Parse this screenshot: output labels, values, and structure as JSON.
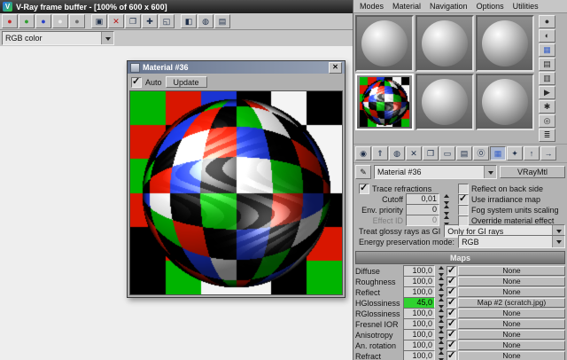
{
  "colors": {
    "sel_green": "#2fd22f",
    "panel": "#b3b3b3",
    "accent_blue": "#3a62c8"
  },
  "vfb": {
    "title": "V-Ray frame buffer - [100% of 600 x 600]",
    "logo_glyph": "V",
    "channel": "RGB color",
    "toolbar": [
      {
        "name": "red-channel-icon",
        "glyph": "●",
        "color": "#c62828"
      },
      {
        "name": "green-channel-icon",
        "glyph": "●",
        "color": "#2e9e2e"
      },
      {
        "name": "blue-channel-icon",
        "glyph": "●",
        "color": "#2840c8"
      },
      {
        "name": "alpha-channel-icon",
        "glyph": "●",
        "color": "#ececec"
      },
      {
        "name": "monochrome-channel-icon",
        "glyph": "●",
        "color": "#6d6d6d"
      },
      {
        "sep": true,
        "glyph": ""
      },
      {
        "name": "save-image-icon",
        "glyph": "▣",
        "color": "#20304a"
      },
      {
        "name": "clear-image-icon",
        "glyph": "✕",
        "color": "#b81616"
      },
      {
        "name": "duplicate-to-host-icon",
        "glyph": "❐",
        "color": "#20304a"
      },
      {
        "name": "track-mouse-icon",
        "glyph": "✚",
        "color": "#20304a"
      },
      {
        "name": "region-render-icon",
        "glyph": "◱",
        "color": "#20304a"
      },
      {
        "sep": true,
        "glyph": ""
      },
      {
        "name": "color-correction-icon",
        "glyph": "◧",
        "color": "#20304a"
      },
      {
        "name": "srgb-icon",
        "glyph": "◍",
        "color": "#20304a"
      },
      {
        "name": "stamp-icon",
        "glyph": "▤",
        "color": "#20304a"
      }
    ]
  },
  "preview": {
    "title": "Material #36",
    "auto_label": "Auto",
    "auto_checked": true,
    "update_label": "Update",
    "palette": [
      "#000000",
      "#f4f4f4",
      "#d81600",
      "#00b400",
      "#1a34d2"
    ],
    "bg_grid": [
      [
        3,
        2,
        4,
        0,
        1,
        0
      ],
      [
        2,
        0,
        3,
        4,
        0,
        1
      ],
      [
        3,
        4,
        0,
        2,
        3,
        1
      ],
      [
        2,
        0,
        3,
        1,
        4,
        0
      ],
      [
        0,
        2,
        4,
        3,
        0,
        2
      ],
      [
        0,
        3,
        1,
        1,
        0,
        3
      ]
    ],
    "sphere_grid": [
      [
        2,
        0,
        3,
        4,
        0,
        2,
        1,
        0
      ],
      [
        0,
        4,
        2,
        0,
        3,
        1,
        0,
        4
      ],
      [
        3,
        0,
        1,
        2,
        4,
        0,
        2,
        0
      ],
      [
        0,
        2,
        4,
        0,
        1,
        3,
        0,
        2
      ],
      [
        4,
        1,
        0,
        3,
        0,
        2,
        4,
        0
      ],
      [
        0,
        3,
        2,
        0,
        4,
        0,
        1,
        3
      ],
      [
        2,
        0,
        4,
        1,
        0,
        3,
        0,
        0
      ],
      [
        0,
        2,
        0,
        3,
        2,
        0,
        4,
        1
      ]
    ]
  },
  "editor": {
    "menus": [
      {
        "name": "menu-modes",
        "label": "Modes"
      },
      {
        "name": "menu-material",
        "label": "Material"
      },
      {
        "name": "menu-navigation",
        "label": "Navigation"
      },
      {
        "name": "menu-options",
        "label": "Options"
      },
      {
        "name": "menu-utilities",
        "label": "Utilities"
      }
    ],
    "vtoolbar": [
      {
        "name": "sample-type-icon",
        "glyph": "●",
        "color": "#2a2a2a"
      },
      {
        "name": "backlight-icon",
        "glyph": "◐",
        "color": "#2a2a2a"
      },
      {
        "name": "background-icon",
        "glyph": "▦",
        "color": "#3a62c8"
      },
      {
        "name": "sample-uv-tiling-icon",
        "glyph": "▤",
        "color": "#2a2a2a"
      },
      {
        "name": "video-color-check-icon",
        "glyph": "▥",
        "color": "#2a2a2a"
      },
      {
        "name": "make-preview-icon",
        "glyph": "▶",
        "color": "#2a2a2a"
      },
      {
        "name": "options-icon",
        "glyph": "✱",
        "color": "#2a2a2a"
      },
      {
        "name": "select-by-material-icon",
        "glyph": "◎",
        "color": "#2a2a2a"
      },
      {
        "name": "material-map-navigator-icon",
        "glyph": "≣",
        "color": "#2a2a2a"
      }
    ],
    "htoolbar": [
      {
        "name": "get-material-icon",
        "glyph": "◉",
        "color": "#20304a"
      },
      {
        "name": "put-material-to-scene-icon",
        "glyph": "⇑",
        "color": "#20304a"
      },
      {
        "name": "assign-material-to-selection-icon",
        "glyph": "◍",
        "color": "#20304a"
      },
      {
        "name": "reset-map-icon",
        "glyph": "✕",
        "color": "#20304a"
      },
      {
        "name": "make-material-copy-icon",
        "glyph": "❐",
        "color": "#20304a"
      },
      {
        "name": "make-unique-icon",
        "glyph": "▭",
        "color": "#20304a"
      },
      {
        "name": "put-to-library-icon",
        "glyph": "▤",
        "color": "#20304a"
      },
      {
        "name": "material-id-channel-icon",
        "glyph": "⓪",
        "color": "#20304a"
      },
      {
        "name": "show-map-in-viewport-icon",
        "glyph": "▦",
        "color": "#3a62c8",
        "pressed": true
      },
      {
        "name": "show-end-result-icon",
        "glyph": "✦",
        "color": "#20304a"
      },
      {
        "name": "go-to-parent-icon",
        "glyph": "↑",
        "color": "#20304a"
      },
      {
        "name": "go-forward-to-sibling-icon",
        "glyph": "→",
        "color": "#20304a"
      }
    ],
    "pick_material_glyph": "✎",
    "material_name": "Material #36",
    "material_type": "VRayMtl",
    "params": {
      "trace_refractions": "Trace refractions",
      "reflect_back": "Reflect on back side",
      "cutoff_label": "Cutoff",
      "cutoff_value": "0,01",
      "use_irradiance": "Use irradiance map",
      "env_priority_label": "Env. priority",
      "env_priority_value": "0",
      "fog_units": "Fog system units scaling",
      "effect_id_label": "Effect ID",
      "effect_id_value": "0",
      "override_effect": "Override material effect",
      "glossy_label": "Treat glossy rays as GI",
      "glossy_value": "Only for GI rays",
      "energy_label": "Energy preservation mode:",
      "energy_value": "RGB"
    },
    "states": {
      "trace_refractions": true,
      "reflect_back": false,
      "use_irradiance": true,
      "fog_units": false,
      "override_effect": false
    },
    "maps": {
      "header": "Maps",
      "rows": [
        {
          "label": "Diffuse",
          "amount": "100,0",
          "map": "None"
        },
        {
          "label": "Roughness",
          "amount": "100,0",
          "map": "None"
        },
        {
          "label": "Reflect",
          "amount": "100,0",
          "map": "None"
        },
        {
          "label": "HGlossiness",
          "amount": "45,0",
          "map": "Map #2 (scratch.jpg)",
          "sel": true
        },
        {
          "label": "RGlossiness",
          "amount": "100,0",
          "map": "None"
        },
        {
          "label": "Fresnel IOR",
          "amount": "100,0",
          "map": "None"
        },
        {
          "label": "Anisotropy",
          "amount": "100,0",
          "map": "None"
        },
        {
          "label": "An. rotation",
          "amount": "100,0",
          "map": "None"
        },
        {
          "label": "Refract",
          "amount": "100,0",
          "map": "None"
        }
      ]
    }
  }
}
